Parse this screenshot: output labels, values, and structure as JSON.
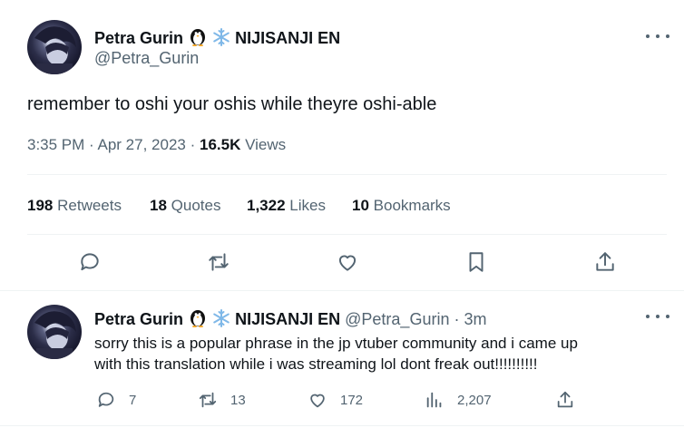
{
  "tweet": {
    "author_name": "Petra Gurin",
    "author_suffix": "NIJISANJI EN",
    "handle": "@Petra_Gurin",
    "text": "remember to oshi your oshis while theyre oshi-able",
    "time": "3:35 PM",
    "date": "Apr 27, 2023",
    "views_count": "16.5K",
    "views_label": "Views",
    "stats": {
      "retweets_count": "198",
      "retweets_label": "Retweets",
      "quotes_count": "18",
      "quotes_label": "Quotes",
      "likes_count": "1,322",
      "likes_label": "Likes",
      "bookmarks_count": "10",
      "bookmarks_label": "Bookmarks"
    }
  },
  "reply": {
    "author_name": "Petra Gurin",
    "author_suffix": "NIJISANJI EN",
    "handle": "@Petra_Gurin",
    "time_ago": "3m",
    "text_line1": "sorry this is a popular phrase in the jp vtuber community and i came up",
    "text_line2": "with this translation while i was streaming lol dont freak out!!!!!!!!!!",
    "replies": "7",
    "retweets": "13",
    "likes": "172",
    "views": "2,207"
  },
  "colors": {
    "text": "#0f1419",
    "muted": "#536471",
    "divider": "#eff3f4",
    "snowflake": "#7fb8e8"
  },
  "icons": [
    "penguin-emoji-icon",
    "snowflake-emoji-icon",
    "more-icon",
    "reply-icon",
    "retweet-icon",
    "like-icon",
    "bookmark-icon",
    "share-icon",
    "analytics-icon"
  ]
}
